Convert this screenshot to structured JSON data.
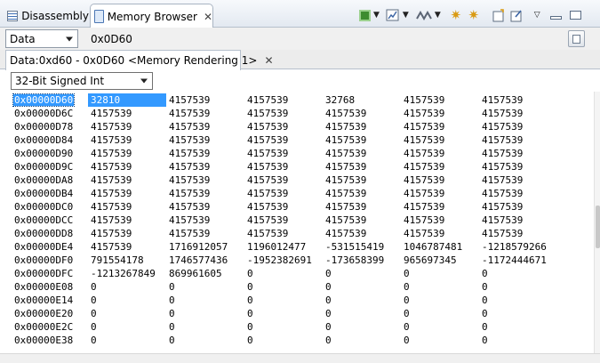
{
  "tabs": [
    {
      "label": "Disassembly",
      "icon": "disassembly-icon",
      "active": false
    },
    {
      "label": "Memory Browser",
      "icon": "memory-browser-icon",
      "active": true
    }
  ],
  "toolbar_icons": [
    "target-chip-icon",
    "dropdown-chevron",
    "memory-chart-icon",
    "dropdown-chevron",
    "link-icon",
    "dropdown-chevron",
    "refresh-gear-icon",
    "sync-gear-icon",
    "new-view-icon",
    "pin-view-icon",
    "view-menu-icon",
    "minimize-icon",
    "maximize-icon"
  ],
  "address_bar": {
    "memory_space": "Data",
    "address": "0x0D60"
  },
  "rendering_tab": {
    "label": "Data:0xd60 - 0x0D60 <Memory Rendering 1>"
  },
  "format_select": "32-Bit Signed Int",
  "memory_rows": [
    {
      "address": "0x00000D60",
      "values": [
        "32810",
        "4157539",
        "4157539",
        "32768",
        "4157539",
        "4157539"
      ]
    },
    {
      "address": "0x00000D6C",
      "values": [
        "4157539",
        "4157539",
        "4157539",
        "4157539",
        "4157539",
        "4157539"
      ]
    },
    {
      "address": "0x00000D78",
      "values": [
        "4157539",
        "4157539",
        "4157539",
        "4157539",
        "4157539",
        "4157539"
      ]
    },
    {
      "address": "0x00000D84",
      "values": [
        "4157539",
        "4157539",
        "4157539",
        "4157539",
        "4157539",
        "4157539"
      ]
    },
    {
      "address": "0x00000D90",
      "values": [
        "4157539",
        "4157539",
        "4157539",
        "4157539",
        "4157539",
        "4157539"
      ]
    },
    {
      "address": "0x00000D9C",
      "values": [
        "4157539",
        "4157539",
        "4157539",
        "4157539",
        "4157539",
        "4157539"
      ]
    },
    {
      "address": "0x00000DA8",
      "values": [
        "4157539",
        "4157539",
        "4157539",
        "4157539",
        "4157539",
        "4157539"
      ]
    },
    {
      "address": "0x00000DB4",
      "values": [
        "4157539",
        "4157539",
        "4157539",
        "4157539",
        "4157539",
        "4157539"
      ]
    },
    {
      "address": "0x00000DC0",
      "values": [
        "4157539",
        "4157539",
        "4157539",
        "4157539",
        "4157539",
        "4157539"
      ]
    },
    {
      "address": "0x00000DCC",
      "values": [
        "4157539",
        "4157539",
        "4157539",
        "4157539",
        "4157539",
        "4157539"
      ]
    },
    {
      "address": "0x00000DD8",
      "values": [
        "4157539",
        "4157539",
        "4157539",
        "4157539",
        "4157539",
        "4157539"
      ]
    },
    {
      "address": "0x00000DE4",
      "values": [
        "4157539",
        "1716912057",
        "1196012477",
        "-531515419",
        "1046787481",
        "-1218579266"
      ]
    },
    {
      "address": "0x00000DF0",
      "values": [
        "791554178",
        "1746577436",
        "-1952382691",
        "-173658399",
        "965697345",
        "-1172444671"
      ]
    },
    {
      "address": "0x00000DFC",
      "values": [
        "-1213267849",
        "869961605",
        "0",
        "0",
        "0",
        "0"
      ]
    },
    {
      "address": "0x00000E08",
      "values": [
        "0",
        "0",
        "0",
        "0",
        "0",
        "0"
      ]
    },
    {
      "address": "0x00000E14",
      "values": [
        "0",
        "0",
        "0",
        "0",
        "0",
        "0"
      ]
    },
    {
      "address": "0x00000E20",
      "values": [
        "0",
        "0",
        "0",
        "0",
        "0",
        "0"
      ]
    },
    {
      "address": "0x00000E2C",
      "values": [
        "0",
        "0",
        "0",
        "0",
        "0",
        "0"
      ]
    },
    {
      "address": "0x00000E38",
      "values": [
        "0",
        "0",
        "0",
        "0",
        "0",
        "0"
      ]
    }
  ],
  "colors": {
    "selection": "#3399ff",
    "tab_border": "#a9b4c2",
    "toolbar_gradient_top": "#f7f9fc"
  }
}
